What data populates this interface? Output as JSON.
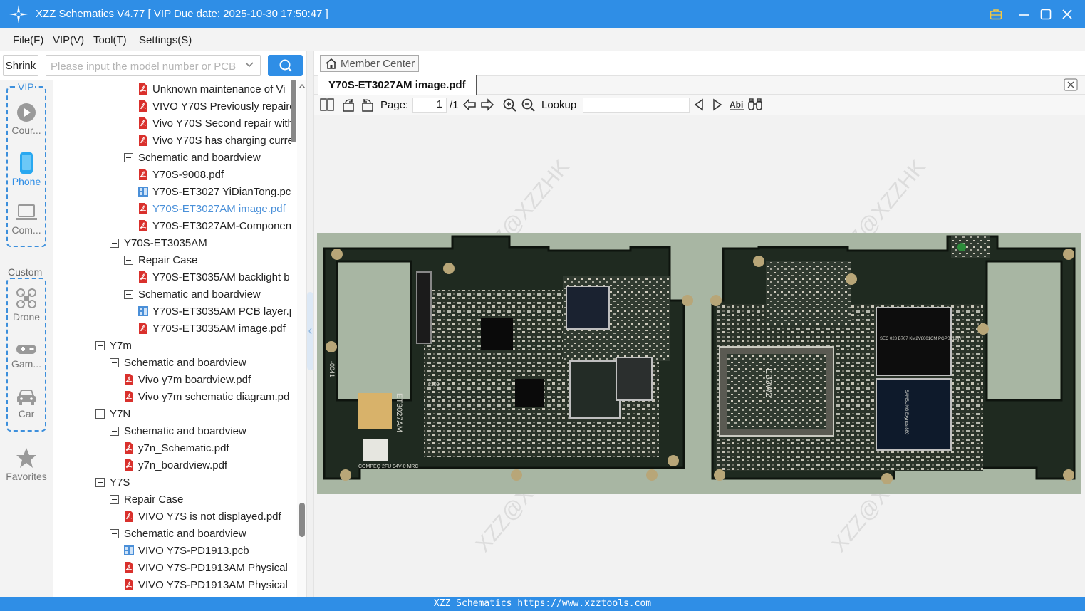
{
  "window": {
    "title": "XZZ Schematics V4.77 [ VIP Due date: 2025-10-30 17:50:47 ]"
  },
  "menu": [
    "File(F)",
    "VIP(V)",
    "Tool(T)",
    "Settings(S)"
  ],
  "toolbar": {
    "shrink_label": "Shrink",
    "search_placeholder": "Please input the model number or PCB"
  },
  "sidebar": {
    "vip_label": "VIP",
    "custom_label": "Custom",
    "items": [
      {
        "label": "Cour...",
        "icon": "play-icon"
      },
      {
        "label": "Phone",
        "icon": "phone-icon",
        "active": true
      },
      {
        "label": "Com...",
        "icon": "laptop-icon"
      },
      {
        "label": "Drone",
        "icon": "drone-icon"
      },
      {
        "label": "Gam...",
        "icon": "gamepad-icon"
      },
      {
        "label": "Car",
        "icon": "car-icon"
      },
      {
        "label": "Favorites",
        "icon": "star-icon"
      }
    ]
  },
  "tree": [
    {
      "label": "Unknown maintenance of Vi",
      "type": "pdf",
      "level": 3
    },
    {
      "label": "VIVO Y70S Previously repaire",
      "type": "pdf",
      "level": 3
    },
    {
      "label": "Vivo Y70S Second repair with",
      "type": "pdf",
      "level": 3
    },
    {
      "label": "Vivo Y70S has charging curre",
      "type": "pdf",
      "level": 3
    },
    {
      "label": "Schematic and boardview",
      "type": "folder",
      "level": 2
    },
    {
      "label": "Y70S-9008.pdf",
      "type": "pdf",
      "level": 3
    },
    {
      "label": "Y70S-ET3027 YiDianTong.pcl",
      "type": "pcb",
      "level": 3
    },
    {
      "label": "Y70S-ET3027AM image.pdf",
      "type": "pdf",
      "level": 3,
      "selected": true
    },
    {
      "label": "Y70S-ET3027AM-Componen",
      "type": "pdf",
      "level": 3
    },
    {
      "label": "Y70S-ET3035AM",
      "type": "folder",
      "level": 1
    },
    {
      "label": "Repair Case",
      "type": "folder",
      "level": 2
    },
    {
      "label": "Y70S-ET3035AM backlight b",
      "type": "pdf",
      "level": 3
    },
    {
      "label": "Schematic and boardview",
      "type": "folder",
      "level": 2
    },
    {
      "label": "Y70S-ET3035AM PCB layer.pı",
      "type": "pcb",
      "level": 3
    },
    {
      "label": "Y70S-ET3035AM image.pdf",
      "type": "pdf",
      "level": 3
    },
    {
      "label": "Y7m",
      "type": "folder",
      "level": 0
    },
    {
      "label": "Schematic and boardview",
      "type": "folder",
      "level": 1
    },
    {
      "label": "Vivo y7m boardview.pdf",
      "type": "pdf",
      "level": 2
    },
    {
      "label": "Vivo y7m schematic diagram.pd",
      "type": "pdf",
      "level": 2
    },
    {
      "label": "Y7N",
      "type": "folder",
      "level": 0
    },
    {
      "label": "Schematic and boardview",
      "type": "folder",
      "level": 1
    },
    {
      "label": "y7n_Schematic.pdf",
      "type": "pdf",
      "level": 2
    },
    {
      "label": "y7n_boardview.pdf",
      "type": "pdf",
      "level": 2
    },
    {
      "label": "Y7S",
      "type": "folder",
      "level": 0
    },
    {
      "label": "Repair Case",
      "type": "folder",
      "level": 1
    },
    {
      "label": "VIVO Y7S is not displayed.pdf",
      "type": "pdf",
      "level": 2
    },
    {
      "label": "Schematic and boardview",
      "type": "folder",
      "level": 1
    },
    {
      "label": "VIVO Y7S-PD1913.pcb",
      "type": "pcb",
      "level": 2
    },
    {
      "label": "VIVO Y7S-PD1913AM Physical l",
      "type": "pdf",
      "level": 2
    },
    {
      "label": "VIVO Y7S-PD1913AM Physical s",
      "type": "pdf",
      "level": 2
    }
  ],
  "viewer": {
    "member_center": "Member Center",
    "tab_title": "Y70S-ET3027AM image.pdf",
    "page_label": "Page:",
    "current_page": "1",
    "total_pages": "/1",
    "lookup_label": "Lookup",
    "image_text": {
      "board_id": "ET3027AM",
      "chip1": "EB3W2",
      "chip2": "SEC 028 B707 KM2V8001CM PGPB619W",
      "chip3": "SAMSUNG Exynos 880",
      "batch": "2109",
      "ul": "COMPEQ 2FU 94V-0 MRC",
      "serial": "-0041",
      "watermark": "XZZ@XZZHK"
    }
  },
  "statusbar": {
    "text": "XZZ Schematics https://www.xzztools.com"
  }
}
